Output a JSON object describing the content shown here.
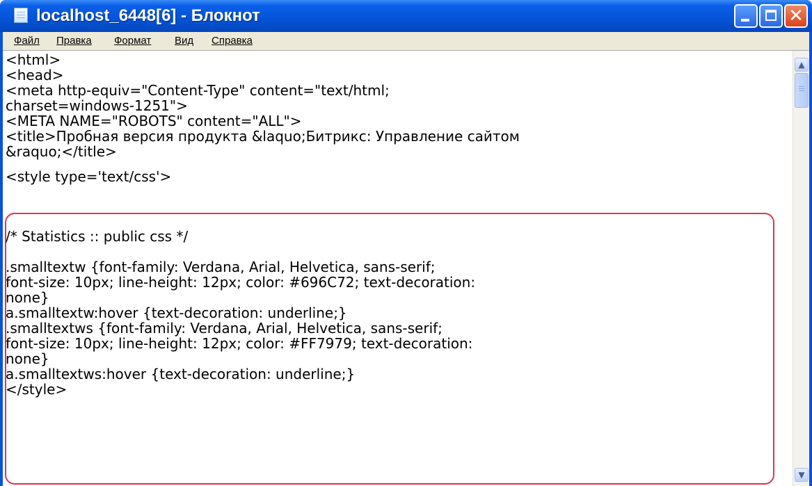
{
  "window": {
    "title": "localhost_6448[6] - Блокнот",
    "icon": "notepad-icon",
    "close_glyph": "✕"
  },
  "menu": {
    "items": [
      "Файл",
      "Правка",
      "Формат",
      "Вид",
      "Справка"
    ]
  },
  "editor": {
    "lines": [
      "<html>",
      "<head>",
      "<meta http-equiv=\"Content-Type\" content=\"text/html;",
      "charset=windows-1251\">",
      "<META NAME=\"ROBOTS\" content=\"ALL\">",
      "<title>Пробная версия продукта &laquo;Битрикс: Управление сайтом",
      "&raquo;</title>",
      "<style type='text/css'>",
      "",
      "",
      "/* Statistics :: public css */",
      "",
      ".smalltextw {font-family: Verdana, Arial, Helvetica, sans-serif;",
      "font-size: 10px; line-height: 12px; color: #696C72; text-decoration:",
      "none}",
      "a.smalltextw:hover {text-decoration: underline;}",
      ".smalltextws {font-family: Verdana, Arial, Helvetica, sans-serif;",
      "font-size: 10px; line-height: 12px; color: #FF7979; text-decoration:",
      "none}",
      "a.smalltextws:hover {text-decoration: underline;}",
      "</style>"
    ]
  },
  "colors": {
    "titlebar": "#0553d6",
    "highlight": "#d9354a",
    "menubar": "#ece9d8"
  }
}
